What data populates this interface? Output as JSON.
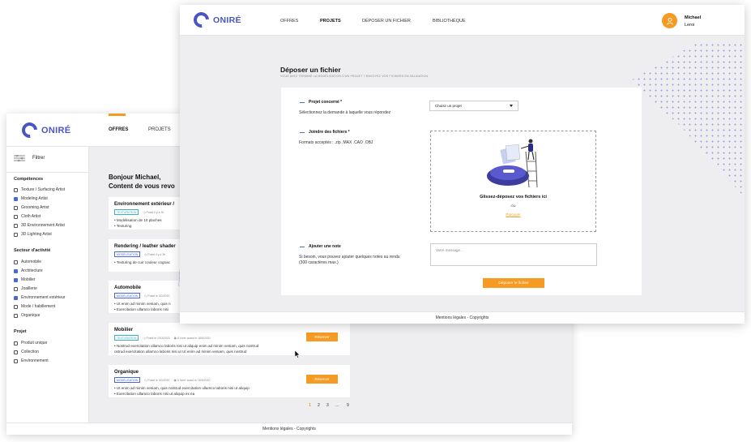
{
  "brand": {
    "name": "ONIRÉ"
  },
  "back_window": {
    "nav": {
      "offres": "OFFRES",
      "projets": "PROJETS"
    },
    "sidebar": {
      "filter_label": "Filtrer",
      "competences": {
        "title": "Compétences",
        "items": [
          {
            "label": "Texture / Surfacing Artist",
            "checked": false
          },
          {
            "label": "Modeling Artist",
            "checked": true
          },
          {
            "label": "Grooming Artist",
            "checked": false
          },
          {
            "label": "Cloth Artist",
            "checked": false
          },
          {
            "label": "3D Environnement Artist",
            "checked": false
          },
          {
            "label": "3D Lighting Artist",
            "checked": false
          }
        ]
      },
      "secteur": {
        "title": "Secteur d'activité",
        "items": [
          {
            "label": "Automobile",
            "checked": false
          },
          {
            "label": "Architecture",
            "checked": true
          },
          {
            "label": "Mobilier",
            "checked": true
          },
          {
            "label": "Joaillerie",
            "checked": false
          },
          {
            "label": "Environnement extérieur",
            "checked": true
          },
          {
            "label": "Mode / habillement",
            "checked": false
          },
          {
            "label": "Organique",
            "checked": false
          }
        ]
      },
      "projet": {
        "title": "Projet",
        "items": [
          {
            "label": "Produit unique",
            "checked": false
          },
          {
            "label": "Collection",
            "checked": false
          },
          {
            "label": "Environnement",
            "checked": false
          }
        ]
      }
    },
    "greeting_line1": "Bonjour Michael,",
    "greeting_line2": "Content de vous revo",
    "cards": [
      {
        "title": "Environnement extérieur /",
        "tag": "TEXTURATION",
        "meta1": "Posté il y a 3h",
        "meta2": "",
        "lines": [
          "• Modélisation de 10 plaches",
          "• Texturing"
        ],
        "button": ""
      },
      {
        "title": "Rendering / leather shader",
        "tag": "MODÉLISATION",
        "meta1": "Posté il y a 3h",
        "meta2": "",
        "lines": [
          "• Texturing de cuir couleur cognac"
        ],
        "button": ""
      },
      {
        "title": "Automobile",
        "tag": "MODÉLISATION",
        "meta1": "Posté le 3/3/2020",
        "meta2": "",
        "lines": [
          "• Ut enim ad minim veniam, quis n",
          "• Exercitation ullamco laboris nisi"
        ],
        "button": ""
      },
      {
        "title": "Mobilier",
        "tag": "TEXTURATION",
        "meta1": "Posté le 23/3/2020",
        "meta2": "À livrer avant le 18/5/2020",
        "lines": [
          "• Nostrud exercitation ullamco laboris nisi ut aliquip enim ad minim veniam, quis nostrud",
          "  ostrud exercitation ullamco laboris nisi ut Ut enim ad minim veniam, quis nostrud"
        ],
        "button": "Réserver"
      },
      {
        "title": "Organique",
        "tag": "MODÉLISATION",
        "meta1": "Posté le 3/3/2020",
        "meta2": "À livrer avant le 18/5/2020",
        "lines": [
          "• Ut enim ad minim veniam, quis nostrud exercitation ullamco laboris nisi ut aliquip",
          "• Exercitation ullamco laboris nisi ut aliquip ex ea"
        ],
        "button": "Réserver"
      }
    ],
    "pagination": [
      "1",
      "2",
      "3",
      "...",
      "9"
    ],
    "footer": "Mentions légales - Copyrights"
  },
  "front_window": {
    "nav": {
      "offres": "OFFRES",
      "projets": "PROJETS",
      "deposer": "DÉPOSER UN FICHIER",
      "bibliotheque": "BIBLIOTHÈQUE"
    },
    "user": {
      "first": "Michael",
      "last": "Leroi"
    },
    "page_title": "Déposer un fichier",
    "page_subtitle": "VOUS AVEZ TERMINÉ LA MODÉLISATION D'UN PROJET ? ENVOYEZ VOS FICHIERS EN VALIDATION",
    "form": {
      "project_label": "Projet concerné *",
      "project_desc": "Sélectionnez la demande à laquelle vous répondez",
      "project_select": "Choisir un projet",
      "files_label": "Joindre des fichiers *",
      "files_desc": "Formats acceptés : .zip .MAX .CAO .OBJ",
      "drop_text": "Glissez-déposez vos fichiers ici",
      "drop_or": "OU",
      "drop_browse": "Parcourir",
      "note_label": "Ajouter une note",
      "note_desc_line1": "Si besoin, vous pouvez ajouter quelques notes au rendu",
      "note_desc_line2": "(300 caractères max.)",
      "note_placeholder": "Votre message...",
      "submit": "Déposer le fichier"
    },
    "footer": "Mentions légales - Copyrights"
  },
  "colors": {
    "brand": "#4a55c5",
    "accent": "#f59a23",
    "checkbox": "#4a67d6"
  }
}
